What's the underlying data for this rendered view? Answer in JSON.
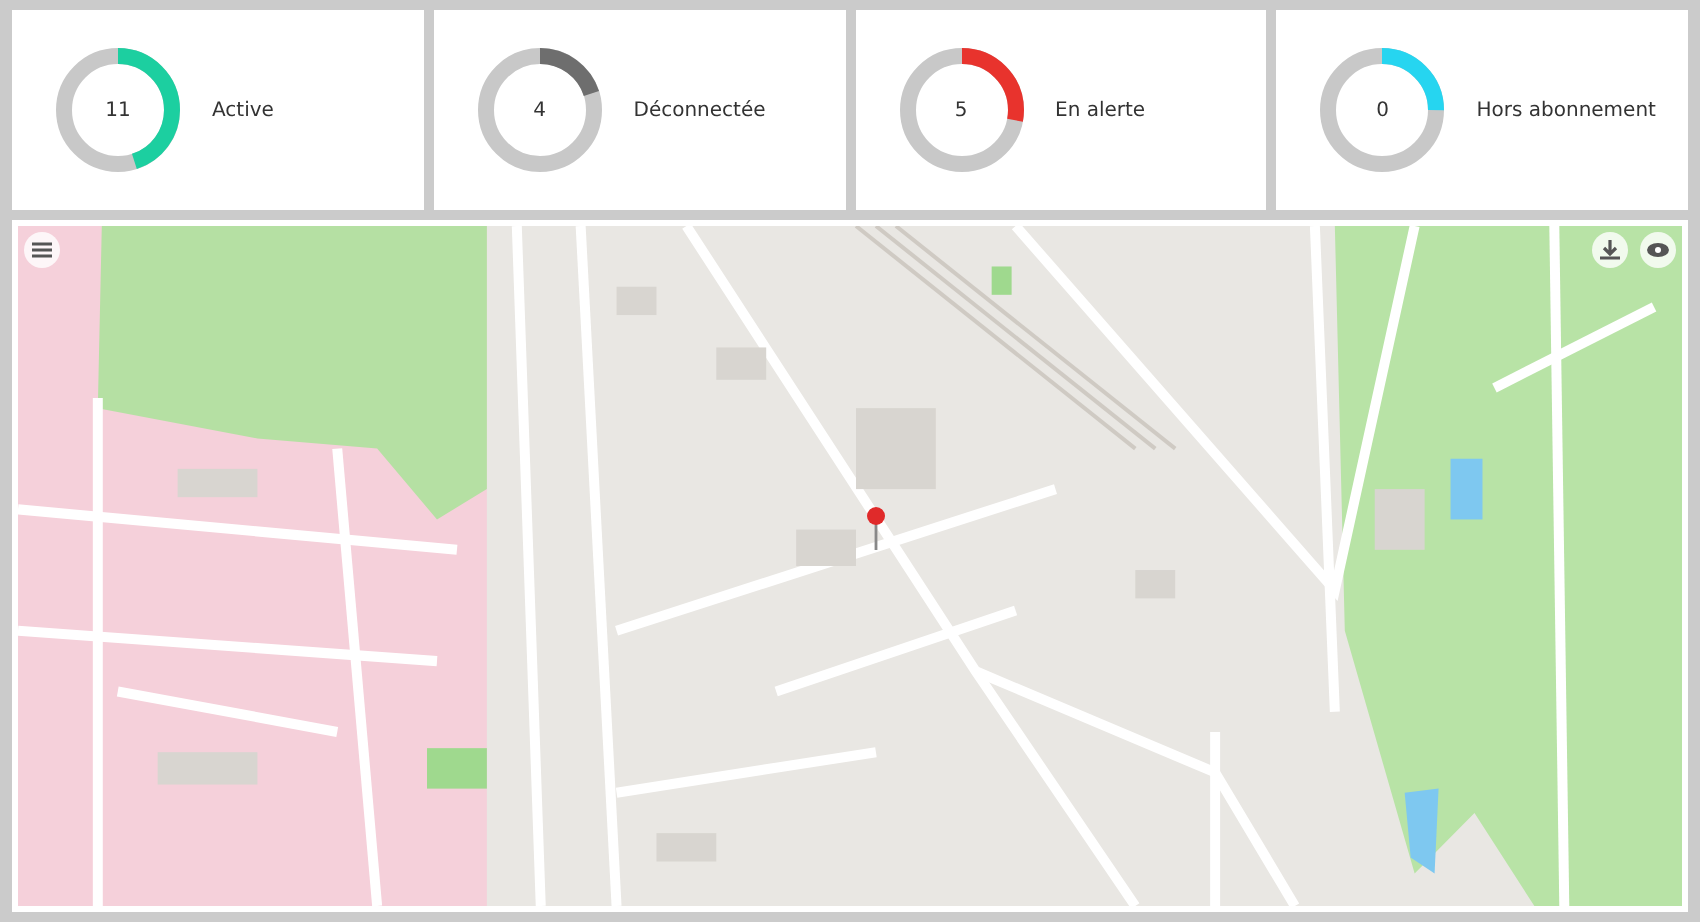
{
  "status_cards": [
    {
      "count": "11",
      "label": "Active",
      "level": 0.45,
      "color": "#1ccfa0"
    },
    {
      "count": "4",
      "label": "Déconnectée",
      "level": 0.2,
      "color": "#6e6e6e"
    },
    {
      "count": "5",
      "label": "En alerte",
      "level": 0.28,
      "color": "#e8332d"
    },
    {
      "count": "0",
      "label": "Hors abonnement",
      "level": 0.25,
      "color": "#26d5f0"
    }
  ]
}
